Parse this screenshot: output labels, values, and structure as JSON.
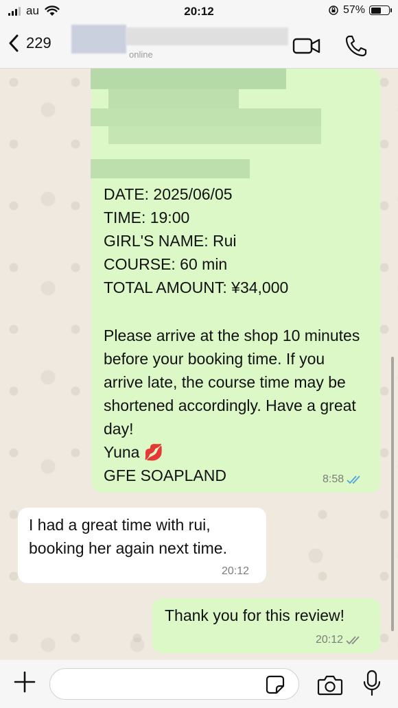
{
  "status_bar": {
    "carrier": "au",
    "time": "20:12",
    "battery_percent": "57%",
    "battery_level": 0.57
  },
  "header": {
    "contact_name": "229",
    "status": "online"
  },
  "messages": {
    "booking": {
      "lines": [
        "DATE: 2025/06/05",
        "TIME: 19:00",
        "GIRL'S NAME: Rui",
        "COURSE: 60 min",
        "TOTAL AMOUNT: ¥34,000"
      ],
      "paragraph": "Please arrive at the shop 10 minutes before your booking time. If you arrive late, the course time may be shortened accordingly. Have a great day!",
      "signature_name": "Yuna 💋",
      "signature_shop": "GFE SOAPLAND",
      "time": "8:58",
      "read": true
    },
    "incoming": {
      "text_line1": "I had a great time with rui,",
      "text_line2": "booking her again next time.",
      "time": "20:12"
    },
    "reply": {
      "text": "Thank you for this review!",
      "time": "20:12",
      "read": false
    }
  },
  "colors": {
    "outgoing_bubble": "#dcf8c6",
    "incoming_bubble": "#ffffff",
    "read_ticks": "#4fa3e0",
    "delivered_ticks": "#8a8a8a"
  },
  "icons": {
    "back": "chevron-left-icon",
    "video": "video-camera-icon",
    "call": "phone-icon",
    "attach": "plus-icon",
    "sticker": "sticker-icon",
    "camera": "camera-icon",
    "mic": "microphone-icon"
  }
}
